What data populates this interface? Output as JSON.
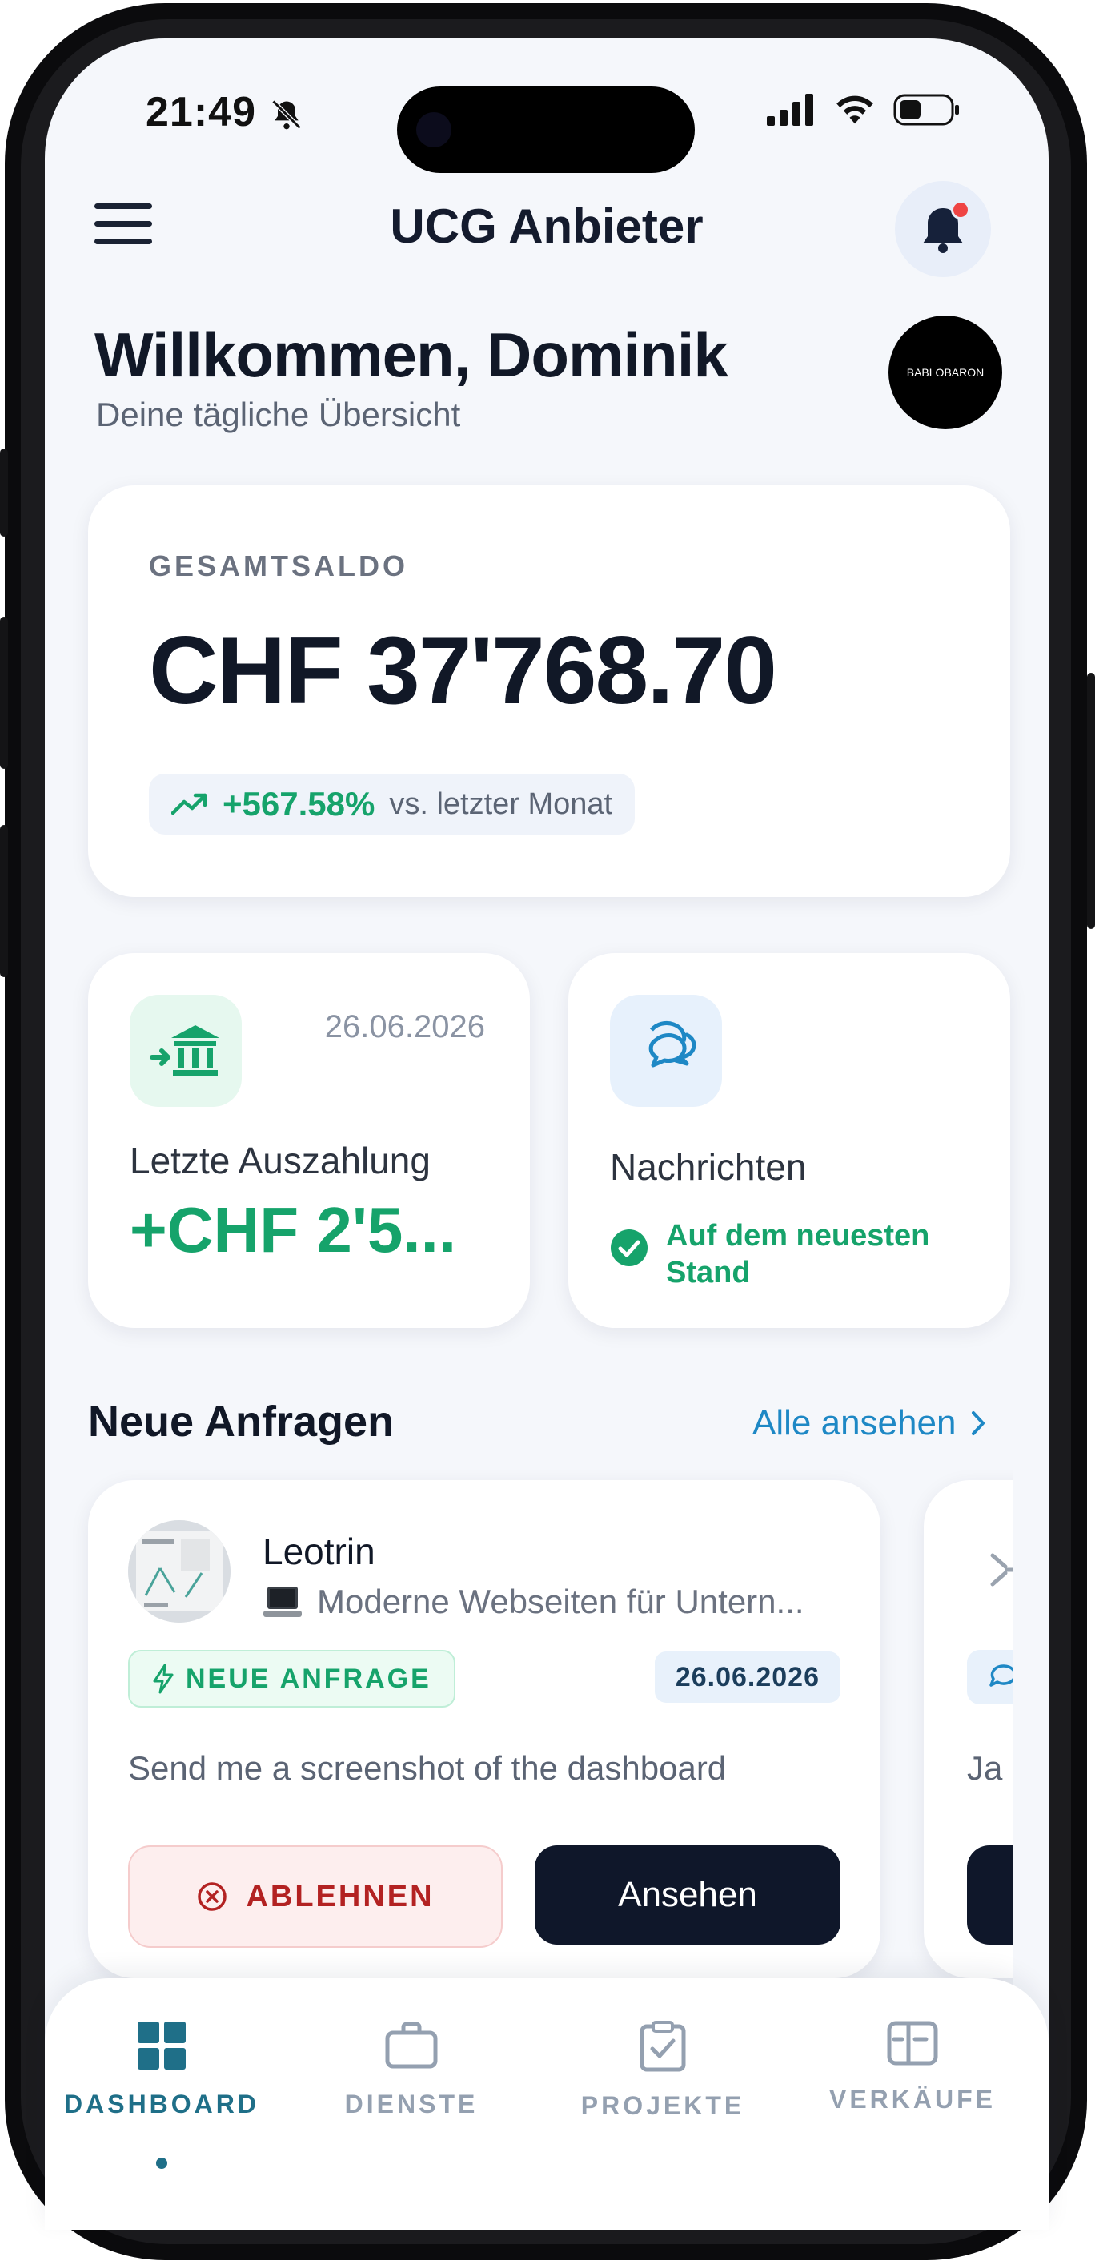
{
  "status_bar": {
    "time": "21:49"
  },
  "header": {
    "title": "UCG Anbieter"
  },
  "welcome": {
    "title": "Willkommen, Dominik",
    "subtitle": "Deine tägliche Übersicht",
    "avatar_text": "BABLOBARON"
  },
  "balance": {
    "label": "GESAMTSALDO",
    "value": "CHF 37'768.70",
    "trend_percent": "+567.58%",
    "trend_text": "vs. letzter Monat"
  },
  "payout": {
    "date": "26.06.2026",
    "label": "Letzte Auszahlung",
    "value": "+CHF 2'5..."
  },
  "messages": {
    "label": "Nachrichten",
    "status": "Auf dem neuesten Stand"
  },
  "requests": {
    "title": "Neue Anfragen",
    "see_all": "Alle ansehen",
    "items": [
      {
        "name": "Leotrin",
        "service": "Moderne Webseiten für Untern...",
        "badge": "NEUE ANFRAGE",
        "date": "26.06.2026",
        "message": "Send me a screenshot of the dashboard",
        "reject_label": "ABLEHNEN",
        "view_label": "Ansehen"
      },
      {
        "message": "Ja"
      }
    ]
  },
  "tabs": [
    {
      "label": "DASHBOARD",
      "icon": "grid-icon",
      "active": true
    },
    {
      "label": "DIENSTE",
      "icon": "briefcase-icon",
      "active": false
    },
    {
      "label": "PROJEKTE",
      "icon": "clipboard-check-icon",
      "active": false
    },
    {
      "label": "VERKÄUFE",
      "icon": "wallet-icon",
      "active": false
    }
  ],
  "colors": {
    "accent_green": "#16a36b",
    "link_blue": "#1e88c5",
    "dark_navy": "#0f172a",
    "tab_active": "#1f6f88",
    "danger": "#b32222"
  }
}
